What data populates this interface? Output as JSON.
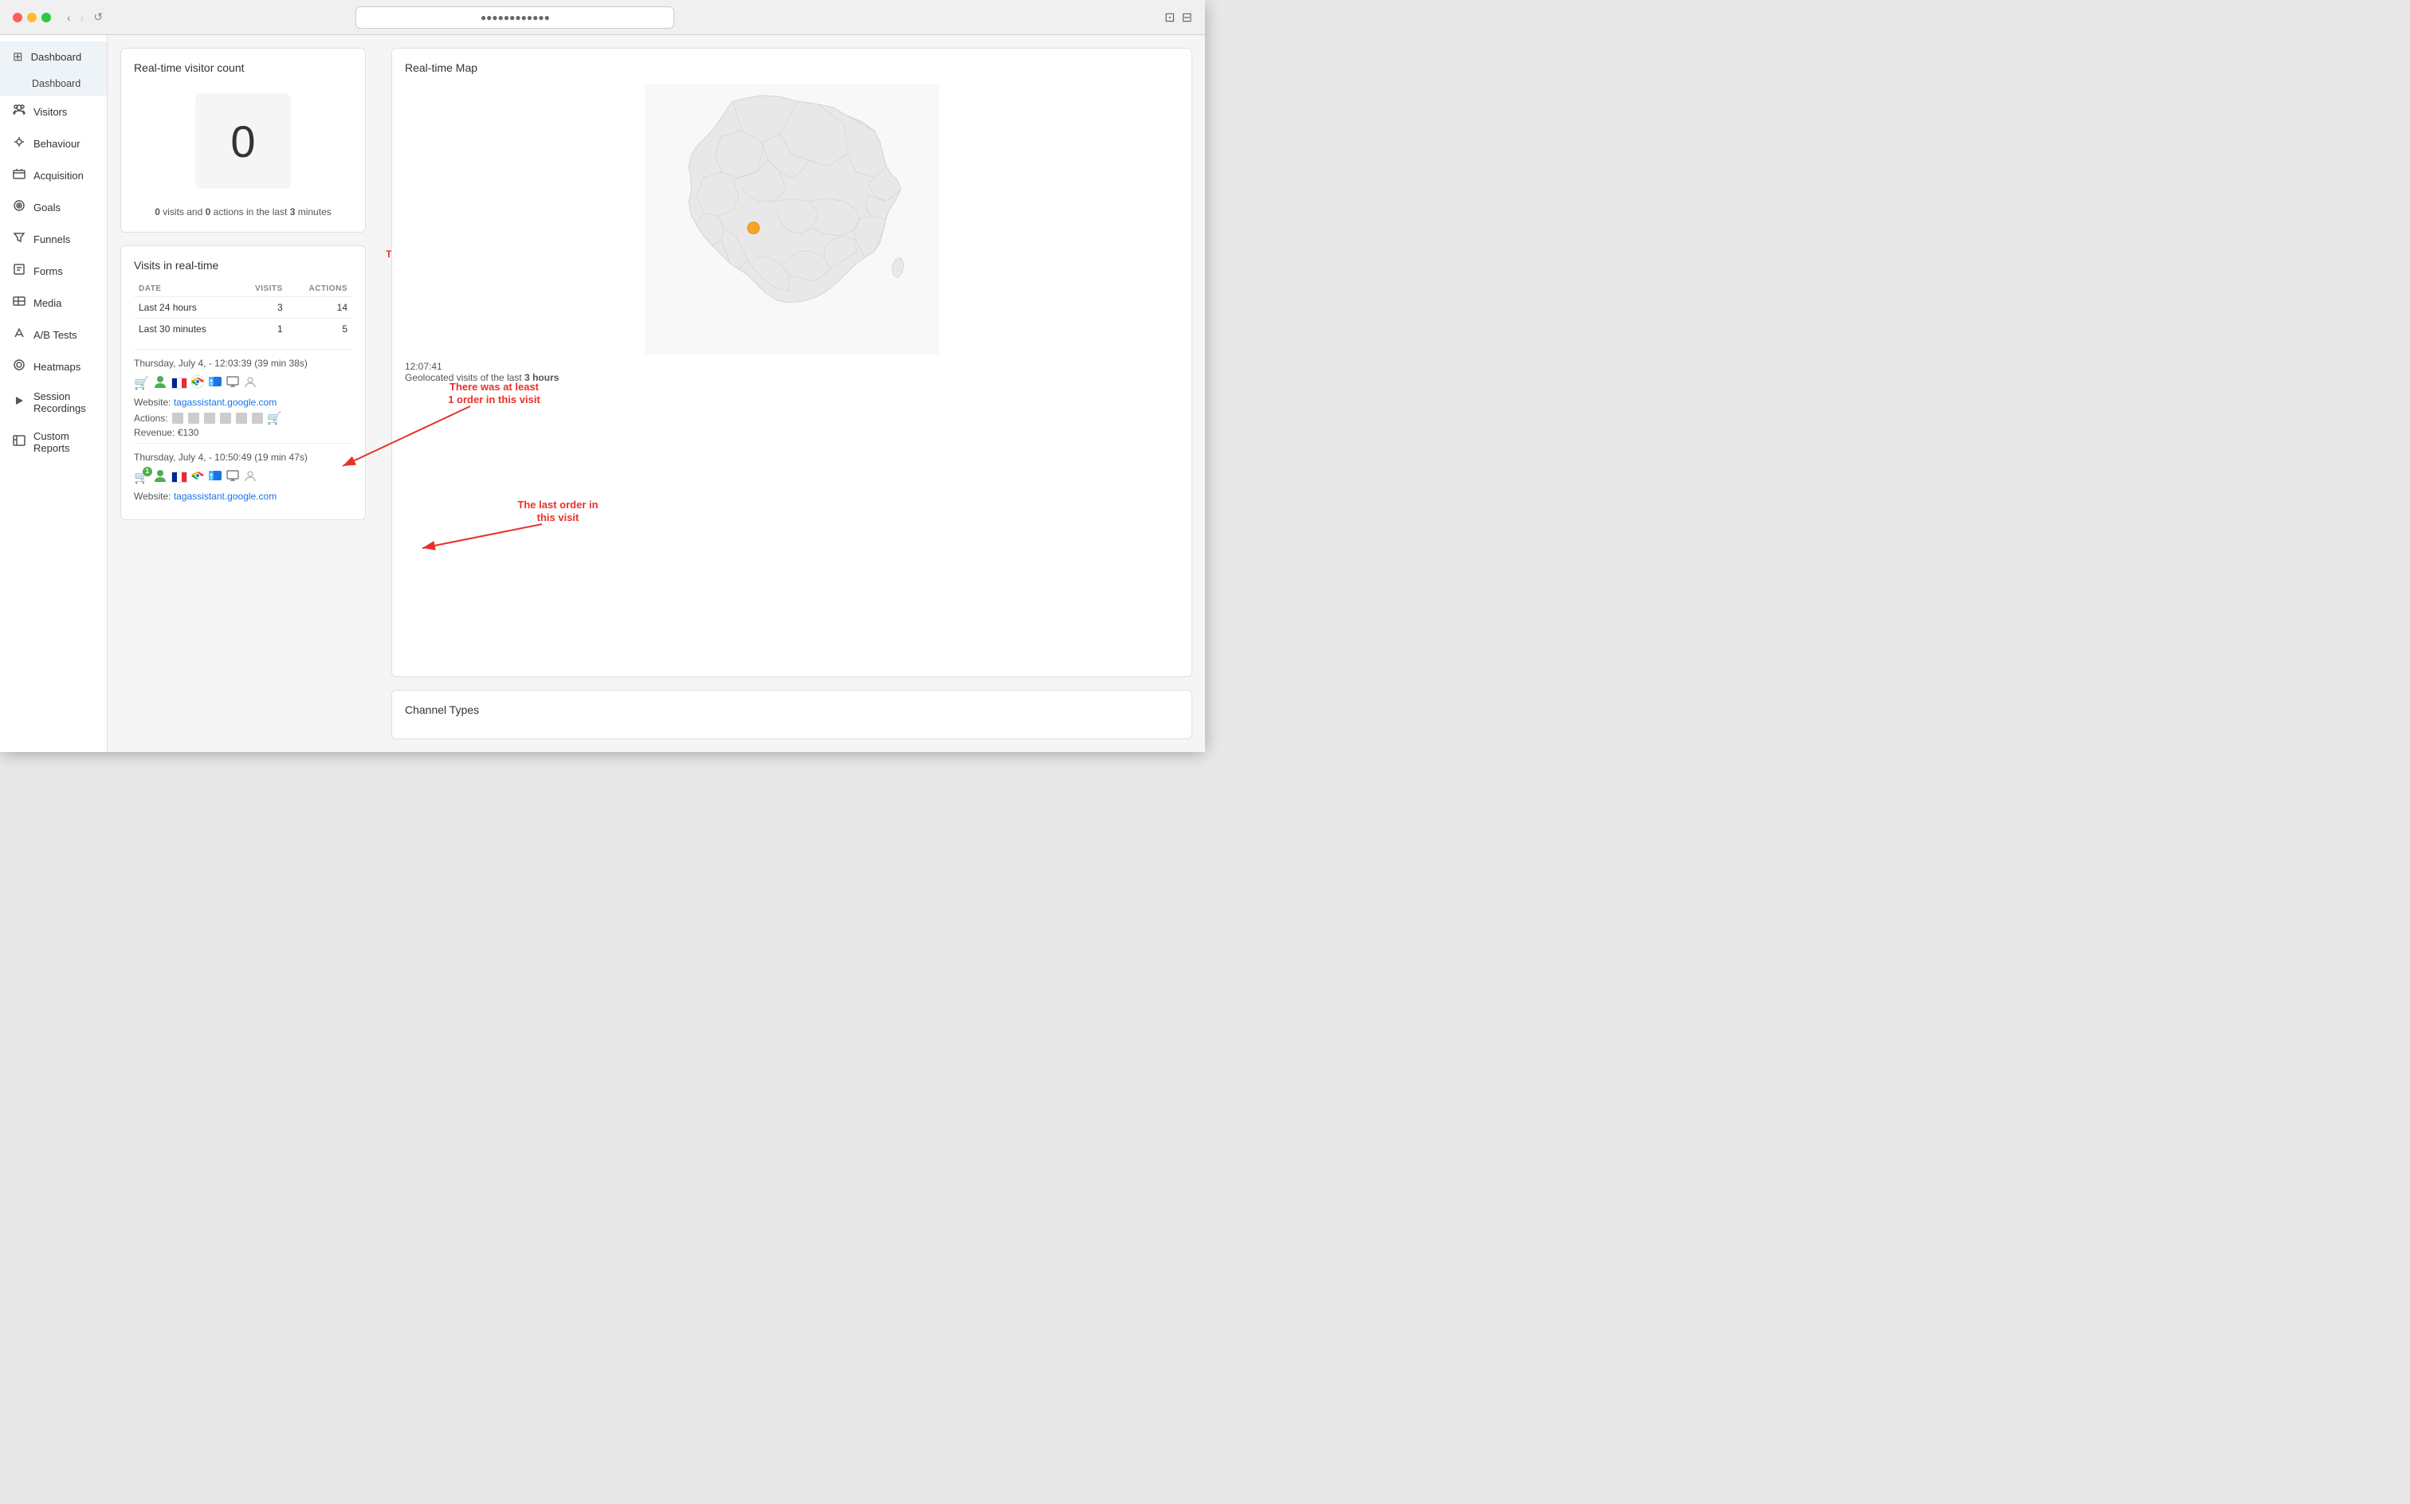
{
  "browser": {
    "back_disabled": false,
    "forward_disabled": false,
    "reload_label": "↺",
    "address": "●●●●●●●●●●●●"
  },
  "sidebar": {
    "items": [
      {
        "id": "dashboard",
        "label": "Dashboard",
        "icon": "⊞",
        "active": true
      },
      {
        "id": "dashboard-sub",
        "label": "Dashboard",
        "sub": true
      },
      {
        "id": "visitors",
        "label": "Visitors",
        "icon": "∞"
      },
      {
        "id": "behaviour",
        "label": "Behaviour",
        "icon": "🔔"
      },
      {
        "id": "acquisition",
        "label": "Acquisition",
        "icon": "▤"
      },
      {
        "id": "goals",
        "label": "Goals",
        "icon": "◎"
      },
      {
        "id": "funnels",
        "label": "Funnels",
        "icon": "▽"
      },
      {
        "id": "forms",
        "label": "Forms",
        "icon": "▢"
      },
      {
        "id": "media",
        "label": "Media",
        "icon": "📊"
      },
      {
        "id": "ab-tests",
        "label": "A/B Tests",
        "icon": "⚗"
      },
      {
        "id": "heatmaps",
        "label": "Heatmaps",
        "icon": "◯"
      },
      {
        "id": "session-recordings",
        "label": "Session Recordings",
        "icon": "▷"
      },
      {
        "id": "custom-reports",
        "label": "Custom Reports",
        "icon": "▦"
      }
    ]
  },
  "realtime_visitor": {
    "title": "Real-time visitor count",
    "count": "0",
    "summary": "0 visits and 0 actions in the last 3 minutes",
    "summary_visits": "0",
    "summary_actions": "0",
    "summary_minutes": "3"
  },
  "realtime_visits": {
    "title": "Visits in real-time",
    "annotation1": "There was at least 1 order in this visit",
    "annotation2": "The last order in this visit",
    "table": {
      "headers": [
        "DATE",
        "VISITS",
        "ACTIONS"
      ],
      "rows": [
        {
          "date": "Last 24 hours",
          "visits": "3",
          "actions": "14"
        },
        {
          "date": "Last 30 minutes",
          "visits": "1",
          "actions": "5"
        }
      ]
    },
    "visit1": {
      "datetime": "Thursday, July 4, - 12:03:39 (39 min 38s)",
      "website_label": "Website:",
      "website_url": "tagassistant.google.com",
      "actions_label": "Actions:",
      "revenue_label": "Revenue:",
      "revenue": "€130"
    },
    "visit2": {
      "datetime": "Thursday, July 4, - 10:50:49 (19 min 47s)",
      "website_label": "Website:",
      "website_url": "tagassistant.google.com",
      "badge": "1"
    }
  },
  "realtime_map": {
    "title": "Real-time Map",
    "timestamp": "12:07:41",
    "geo_label": "Geolocated visits of the last",
    "geo_hours": "3 hours"
  },
  "channel_types": {
    "title": "Channel Types"
  },
  "colors": {
    "accent": "#1a73e8",
    "annotation": "#e8312a",
    "orange_dot": "#f5a623"
  }
}
